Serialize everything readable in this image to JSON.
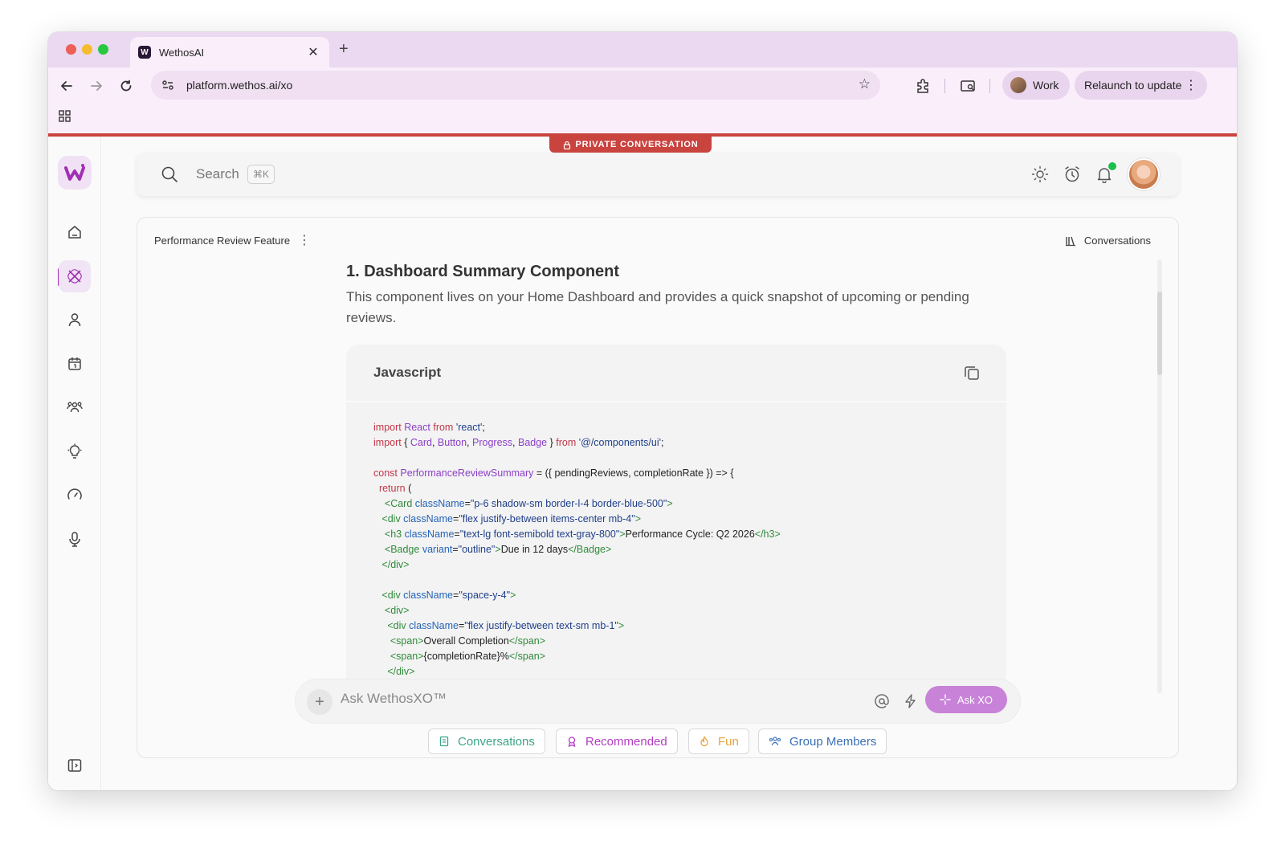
{
  "browser": {
    "tab_title": "WethosAI",
    "tab_favicon": "W",
    "url": "platform.wethos.ai/xo",
    "profile_label": "Work",
    "relaunch_label": "Relaunch to update"
  },
  "banner": {
    "private_label": "PRIVATE CONVERSATION"
  },
  "search": {
    "placeholder": "Search",
    "shortcut": "⌘K"
  },
  "conversation": {
    "title": "Performance Review Feature",
    "conversations_link": "Conversations"
  },
  "section": {
    "heading": "1. Dashboard Summary Component",
    "description": "This component lives on your Home Dashboard and provides a quick snapshot of upcoming or pending reviews."
  },
  "code": {
    "language": "Javascript",
    "lines": [
      [
        [
          "kw",
          "import "
        ],
        [
          "fn",
          "React "
        ],
        [
          "kw",
          "from "
        ],
        [
          "str",
          "'react'"
        ],
        [
          "txt",
          ";"
        ]
      ],
      [
        [
          "kw",
          "import "
        ],
        [
          "txt",
          "{ "
        ],
        [
          "fn",
          "Card"
        ],
        [
          "txt",
          ", "
        ],
        [
          "fn",
          "Button"
        ],
        [
          "txt",
          ", "
        ],
        [
          "fn",
          "Progress"
        ],
        [
          "txt",
          ", "
        ],
        [
          "fn",
          "Badge "
        ],
        [
          "txt",
          "} "
        ],
        [
          "kw",
          "from "
        ],
        [
          "str",
          "'@/components/ui'"
        ],
        [
          "txt",
          ";"
        ]
      ],
      [],
      [
        [
          "kw",
          "const "
        ],
        [
          "fn",
          "PerformanceReviewSummary "
        ],
        [
          "txt",
          "= ({ pendingReviews, completionRate }) => {"
        ]
      ],
      [
        [
          "kw",
          "  return "
        ],
        [
          "txt",
          "("
        ]
      ],
      [
        [
          "tag",
          "    <Card "
        ],
        [
          "attr",
          "className"
        ],
        [
          "txt",
          "="
        ],
        [
          "str",
          "\"p-6 shadow-sm border-l-4 border-blue-500\""
        ],
        [
          "tag",
          ">"
        ]
      ],
      [
        [
          "tag",
          "   <div "
        ],
        [
          "attr",
          "className"
        ],
        [
          "txt",
          "="
        ],
        [
          "str",
          "\"flex justify-between items-center mb-4\""
        ],
        [
          "tag",
          ">"
        ]
      ],
      [
        [
          "tag",
          "    <h3 "
        ],
        [
          "attr",
          "className"
        ],
        [
          "txt",
          "="
        ],
        [
          "str",
          "\"text-lg font-semibold text-gray-800\""
        ],
        [
          "tag",
          ">"
        ],
        [
          "txt",
          "Performance Cycle: Q2 2026"
        ],
        [
          "tag",
          "</h3>"
        ]
      ],
      [
        [
          "tag",
          "    <Badge "
        ],
        [
          "attr",
          "variant"
        ],
        [
          "txt",
          "="
        ],
        [
          "str",
          "\"outline\""
        ],
        [
          "tag",
          ">"
        ],
        [
          "txt",
          "Due in 12 days"
        ],
        [
          "tag",
          "</Badge>"
        ]
      ],
      [
        [
          "tag",
          "   </div>"
        ]
      ],
      [],
      [
        [
          "tag",
          "   <div "
        ],
        [
          "attr",
          "className"
        ],
        [
          "txt",
          "="
        ],
        [
          "str",
          "\"space-y-4\""
        ],
        [
          "tag",
          ">"
        ]
      ],
      [
        [
          "tag",
          "    <div>"
        ]
      ],
      [
        [
          "tag",
          "     <div "
        ],
        [
          "attr",
          "className"
        ],
        [
          "txt",
          "="
        ],
        [
          "str",
          "\"flex justify-between text-sm mb-1\""
        ],
        [
          "tag",
          ">"
        ]
      ],
      [
        [
          "tag",
          "      <span>"
        ],
        [
          "txt",
          "Overall Completion"
        ],
        [
          "tag",
          "</span>"
        ]
      ],
      [
        [
          "tag",
          "      <span>"
        ],
        [
          "txt",
          "{completionRate}%"
        ],
        [
          "tag",
          "</span>"
        ]
      ],
      [
        [
          "tag",
          "     </div>"
        ]
      ]
    ]
  },
  "composer": {
    "placeholder": "Ask WethosXO™",
    "ask_button": "Ask XO"
  },
  "chips": [
    {
      "label": "Conversations",
      "color": "#3aa58a"
    },
    {
      "label": "Recommended",
      "color": "#b23dc2"
    },
    {
      "label": "Fun",
      "color": "#e8a33a"
    },
    {
      "label": "Group Members",
      "color": "#3a6fb5"
    }
  ],
  "colors": {
    "accent": "#a02fb4",
    "private_banner": "#c9433f",
    "notification_dot": "#1bbf4c",
    "ask_button": "#c882d8"
  }
}
